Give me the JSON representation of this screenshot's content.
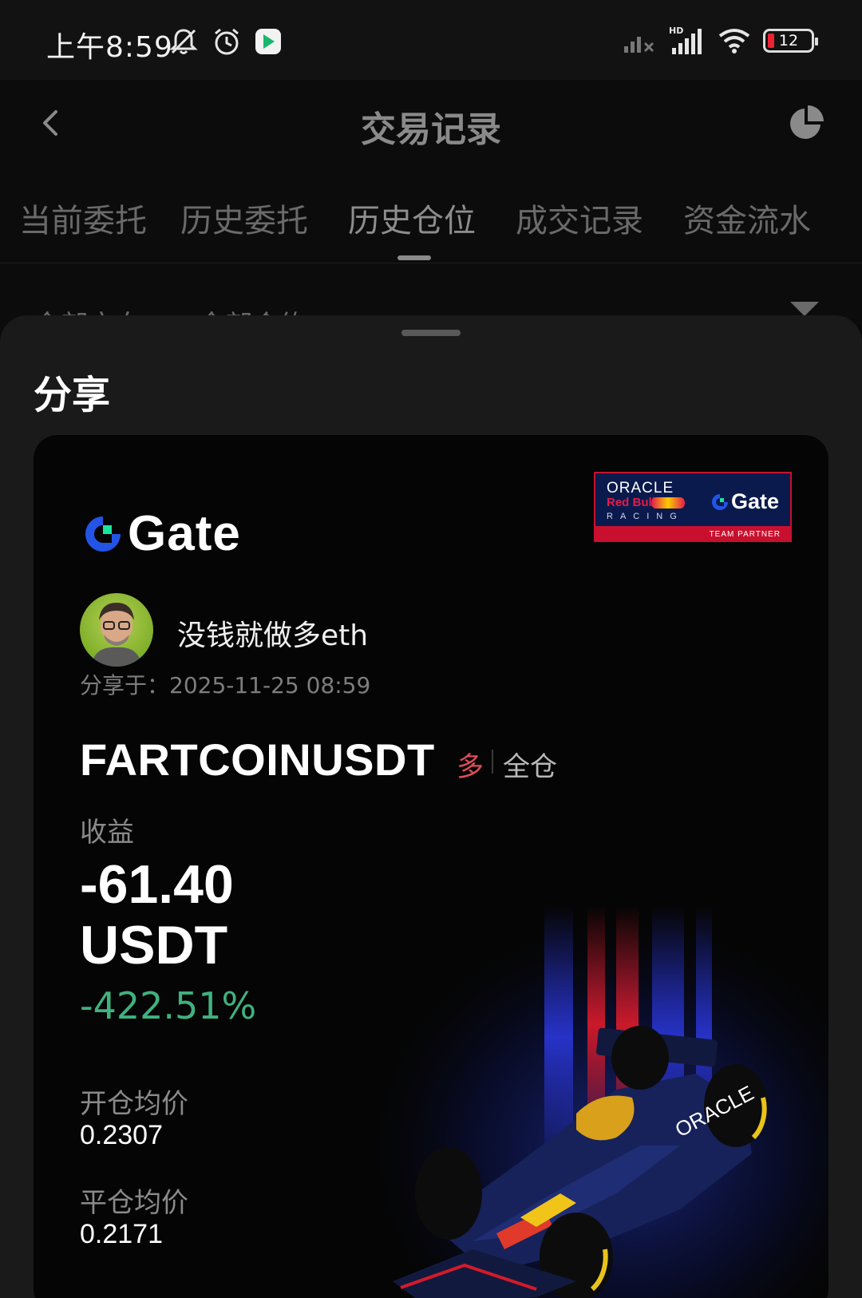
{
  "status_bar": {
    "time": "上午8:59",
    "battery": "12"
  },
  "header": {
    "title": "交易记录"
  },
  "tabs": [
    {
      "label": "当前委托"
    },
    {
      "label": "历史委托"
    },
    {
      "label": "历史仓位"
    },
    {
      "label": "成交记录"
    },
    {
      "label": "资金流水"
    }
  ],
  "active_tab_index": 2,
  "filters": [
    {
      "label": "全部方向"
    },
    {
      "label": "全部合约"
    }
  ],
  "sheet": {
    "title": "分享"
  },
  "card": {
    "brand": "Gate",
    "partner": {
      "oracle": "ORACLE",
      "redbull": "Red Bull",
      "racing": "RACING",
      "gate": "Gate",
      "team_partner": "TEAM PARTNER"
    },
    "username": "没钱就做多eth",
    "share_time": "分享于：2025-11-25 08:59",
    "symbol": "FARTCOINUSDT",
    "side": "多",
    "margin_mode": "全仓",
    "pnl_label": "收益",
    "pnl_value": "-61.40",
    "pnl_unit": "USDT",
    "pnl_rate": "-422.51%",
    "entry_label": "开仓均价",
    "entry_price": "0.2307",
    "exit_label": "平仓均价",
    "exit_price": "0.2171"
  },
  "colors": {
    "loss_rate": "#3fb27f",
    "side_long": "#e24b5a",
    "brand_blue": "#2354e6",
    "sheet_bg": "#1a1a1a",
    "card_bg": "#050505"
  },
  "icons": {
    "back": "chevron-left-icon",
    "chart": "pie-chart-icon",
    "filter": "filter-triangle-icon"
  }
}
